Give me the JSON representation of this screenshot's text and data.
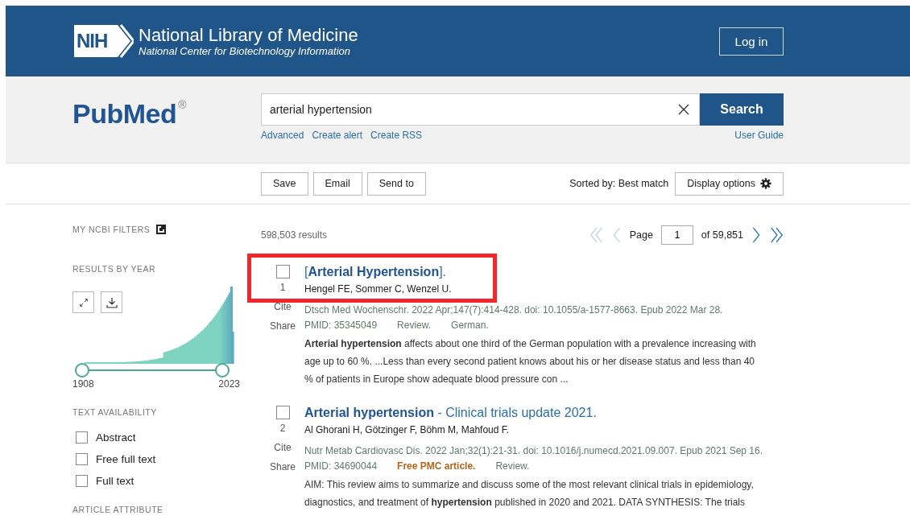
{
  "header": {
    "org_mark": "NIH",
    "org_title": "National Library of Medicine",
    "org_subtitle": "National Center for Biotechnology Information",
    "login": "Log in"
  },
  "search": {
    "logo": "PubMed",
    "logo_mark": "®",
    "value": "arterial hypertension",
    "button": "Search",
    "links": [
      "Advanced",
      "Create alert",
      "Create RSS"
    ],
    "user_guide": "User Guide"
  },
  "toolbar": {
    "buttons": [
      "Save",
      "Email",
      "Send to"
    ],
    "sort_label": "Sorted by: Best match",
    "display_options": "Display options"
  },
  "sidebar": {
    "ncbi_filters": "MY NCBI FILTERS",
    "results_by_year": {
      "title": "RESULTS BY YEAR",
      "start_year": "1908",
      "end_year": "2023",
      "level": 1
    },
    "text_availability": {
      "title": "TEXT AVAILABILITY",
      "options": [
        {
          "label": "Abstract",
          "checked": false
        },
        {
          "label": "Free full text",
          "checked": false
        },
        {
          "label": "Full text",
          "checked": false
        }
      ]
    },
    "article_attribute": "ARTICLE ATTRIBUTE"
  },
  "results": {
    "count": "598,503 results",
    "pagination": {
      "page_label": "Page",
      "page": "1",
      "of": "of 59,851"
    },
    "items": [
      {
        "number": "1",
        "checked": false,
        "highlighted": true,
        "title": "[**Arterial Hypertension**].",
        "authors": "Hengel FE, Sommer C, Wenzel U.",
        "citation": "Dtsch Med Wochenschr. 2022 Apr;147(7):414-428. doi: 10.1055/a-1577-8663. Epub 2022 Mar 28.",
        "pmid": "PMID: 35345049",
        "tags": [
          {
            "label": "Review.",
            "kind": "plain"
          },
          {
            "label": "German.",
            "kind": "plain"
          }
        ],
        "snippet": "**Arterial hypertension** affects about one third of the German population with a prevalence increasing with age up to 60 %. ...Less than every second patient knows about his or her disease status and less than 40 % of patients in Europe show adequate blood pressure con ...",
        "cite": "Cite",
        "share": "Share"
      },
      {
        "number": "2",
        "checked": false,
        "highlighted": false,
        "title": "**Arterial hypertension** - Clinical trials update 2021.",
        "authors": "Al Ghorani H, Götzinger F, Böhm M, Mahfoud F.",
        "citation": "Nutr Metab Cardiovasc Dis. 2022 Jan;32(1):21-31. doi: 10.1016/j.numecd.2021.09.007. Epub 2021 Sep 16.",
        "pmid": "PMID: 34690044",
        "tags": [
          {
            "label": "Free PMC article.",
            "kind": "free"
          },
          {
            "label": "Review.",
            "kind": "plain"
          }
        ],
        "snippet": "AIM: This review aims to summarize and discuss some of the most relevant clinical trials in epidemiology, diagnostics, and treatment of **hypertension** published in 2020 and 2021. DATA SYNTHESIS: The trials",
        "cite": "Cite",
        "share": "Share"
      }
    ]
  }
}
